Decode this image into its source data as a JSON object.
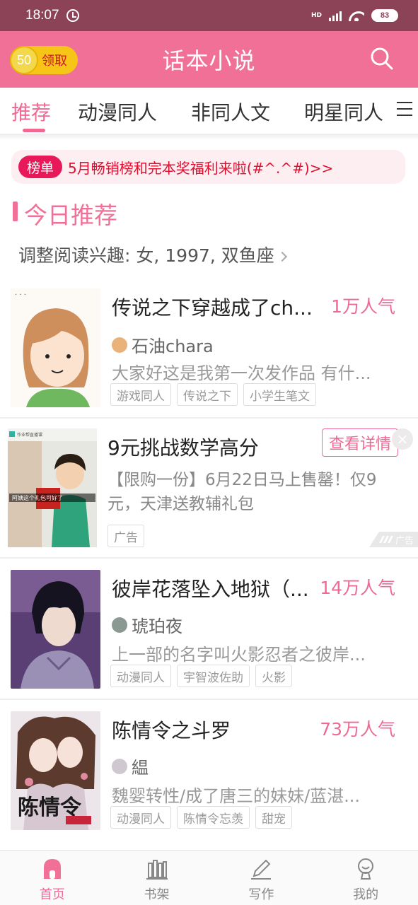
{
  "status_bar": {
    "time": "18:07",
    "network_label": "HD",
    "battery": "83"
  },
  "header": {
    "coin_amount": "50",
    "coin_label": "领取",
    "title": "话本小说",
    "search_icon": "search-icon"
  },
  "tabs": {
    "items": [
      {
        "label": "推荐",
        "active": true
      },
      {
        "label": "动漫同人"
      },
      {
        "label": "非同人文"
      },
      {
        "label": "明星同人"
      }
    ],
    "more_icon": "menu-icon"
  },
  "banner": {
    "badge": "榜单",
    "text": "5月畅销榜和完本奖福利来啦(#^.^#)>>"
  },
  "section": {
    "title": "今日推荐",
    "interest": "调整阅读兴趣: 女, 1997, 双鱼座"
  },
  "books": [
    {
      "title": "传说之下穿越成了ch...",
      "popularity": "1万人气",
      "author": "石油chara",
      "description": "大家好这是我第一次发作品 有什...",
      "tags": [
        "游戏同人",
        "传说之下",
        "小学生笔文"
      ]
    },
    {
      "title": "彼岸花落坠入地狱（...",
      "popularity": "14万人气",
      "author": "琥珀夜",
      "description": "上一部的名字叫火影忍者之彼岸...",
      "tags": [
        "动漫同人",
        "宇智波佐助",
        "火影"
      ]
    },
    {
      "title": "陈情令之斗罗",
      "popularity": "73万人气",
      "author": "緼",
      "description": "魏婴转性/成了唐三的妹妹/蓝湛...",
      "tags": [
        "动漫同人",
        "陈情令忘羡",
        "甜宠"
      ]
    }
  ],
  "ad": {
    "title": "9元挑战数学高分",
    "detail_button": "查看详情",
    "description": "【限购一份】6月22日马上售罄！仅9元，天津送教辅礼包",
    "tag": "广告",
    "ad_mark": "广告",
    "image_caption": "阿姨这个礼包可好了",
    "image_brand": "作业帮直播课"
  },
  "bottom_nav": [
    {
      "label": "首页",
      "icon": "home-icon",
      "active": true
    },
    {
      "label": "书架",
      "icon": "bookshelf-icon"
    },
    {
      "label": "写作",
      "icon": "pen-icon"
    },
    {
      "label": "我的",
      "icon": "profile-icon"
    }
  ],
  "colors": {
    "brand_pink": "#f07098",
    "accent_pink": "#ee6a93",
    "status_bar": "#8c4358",
    "coin_yellow": "#f6c518",
    "banner_red": "#e01030"
  }
}
